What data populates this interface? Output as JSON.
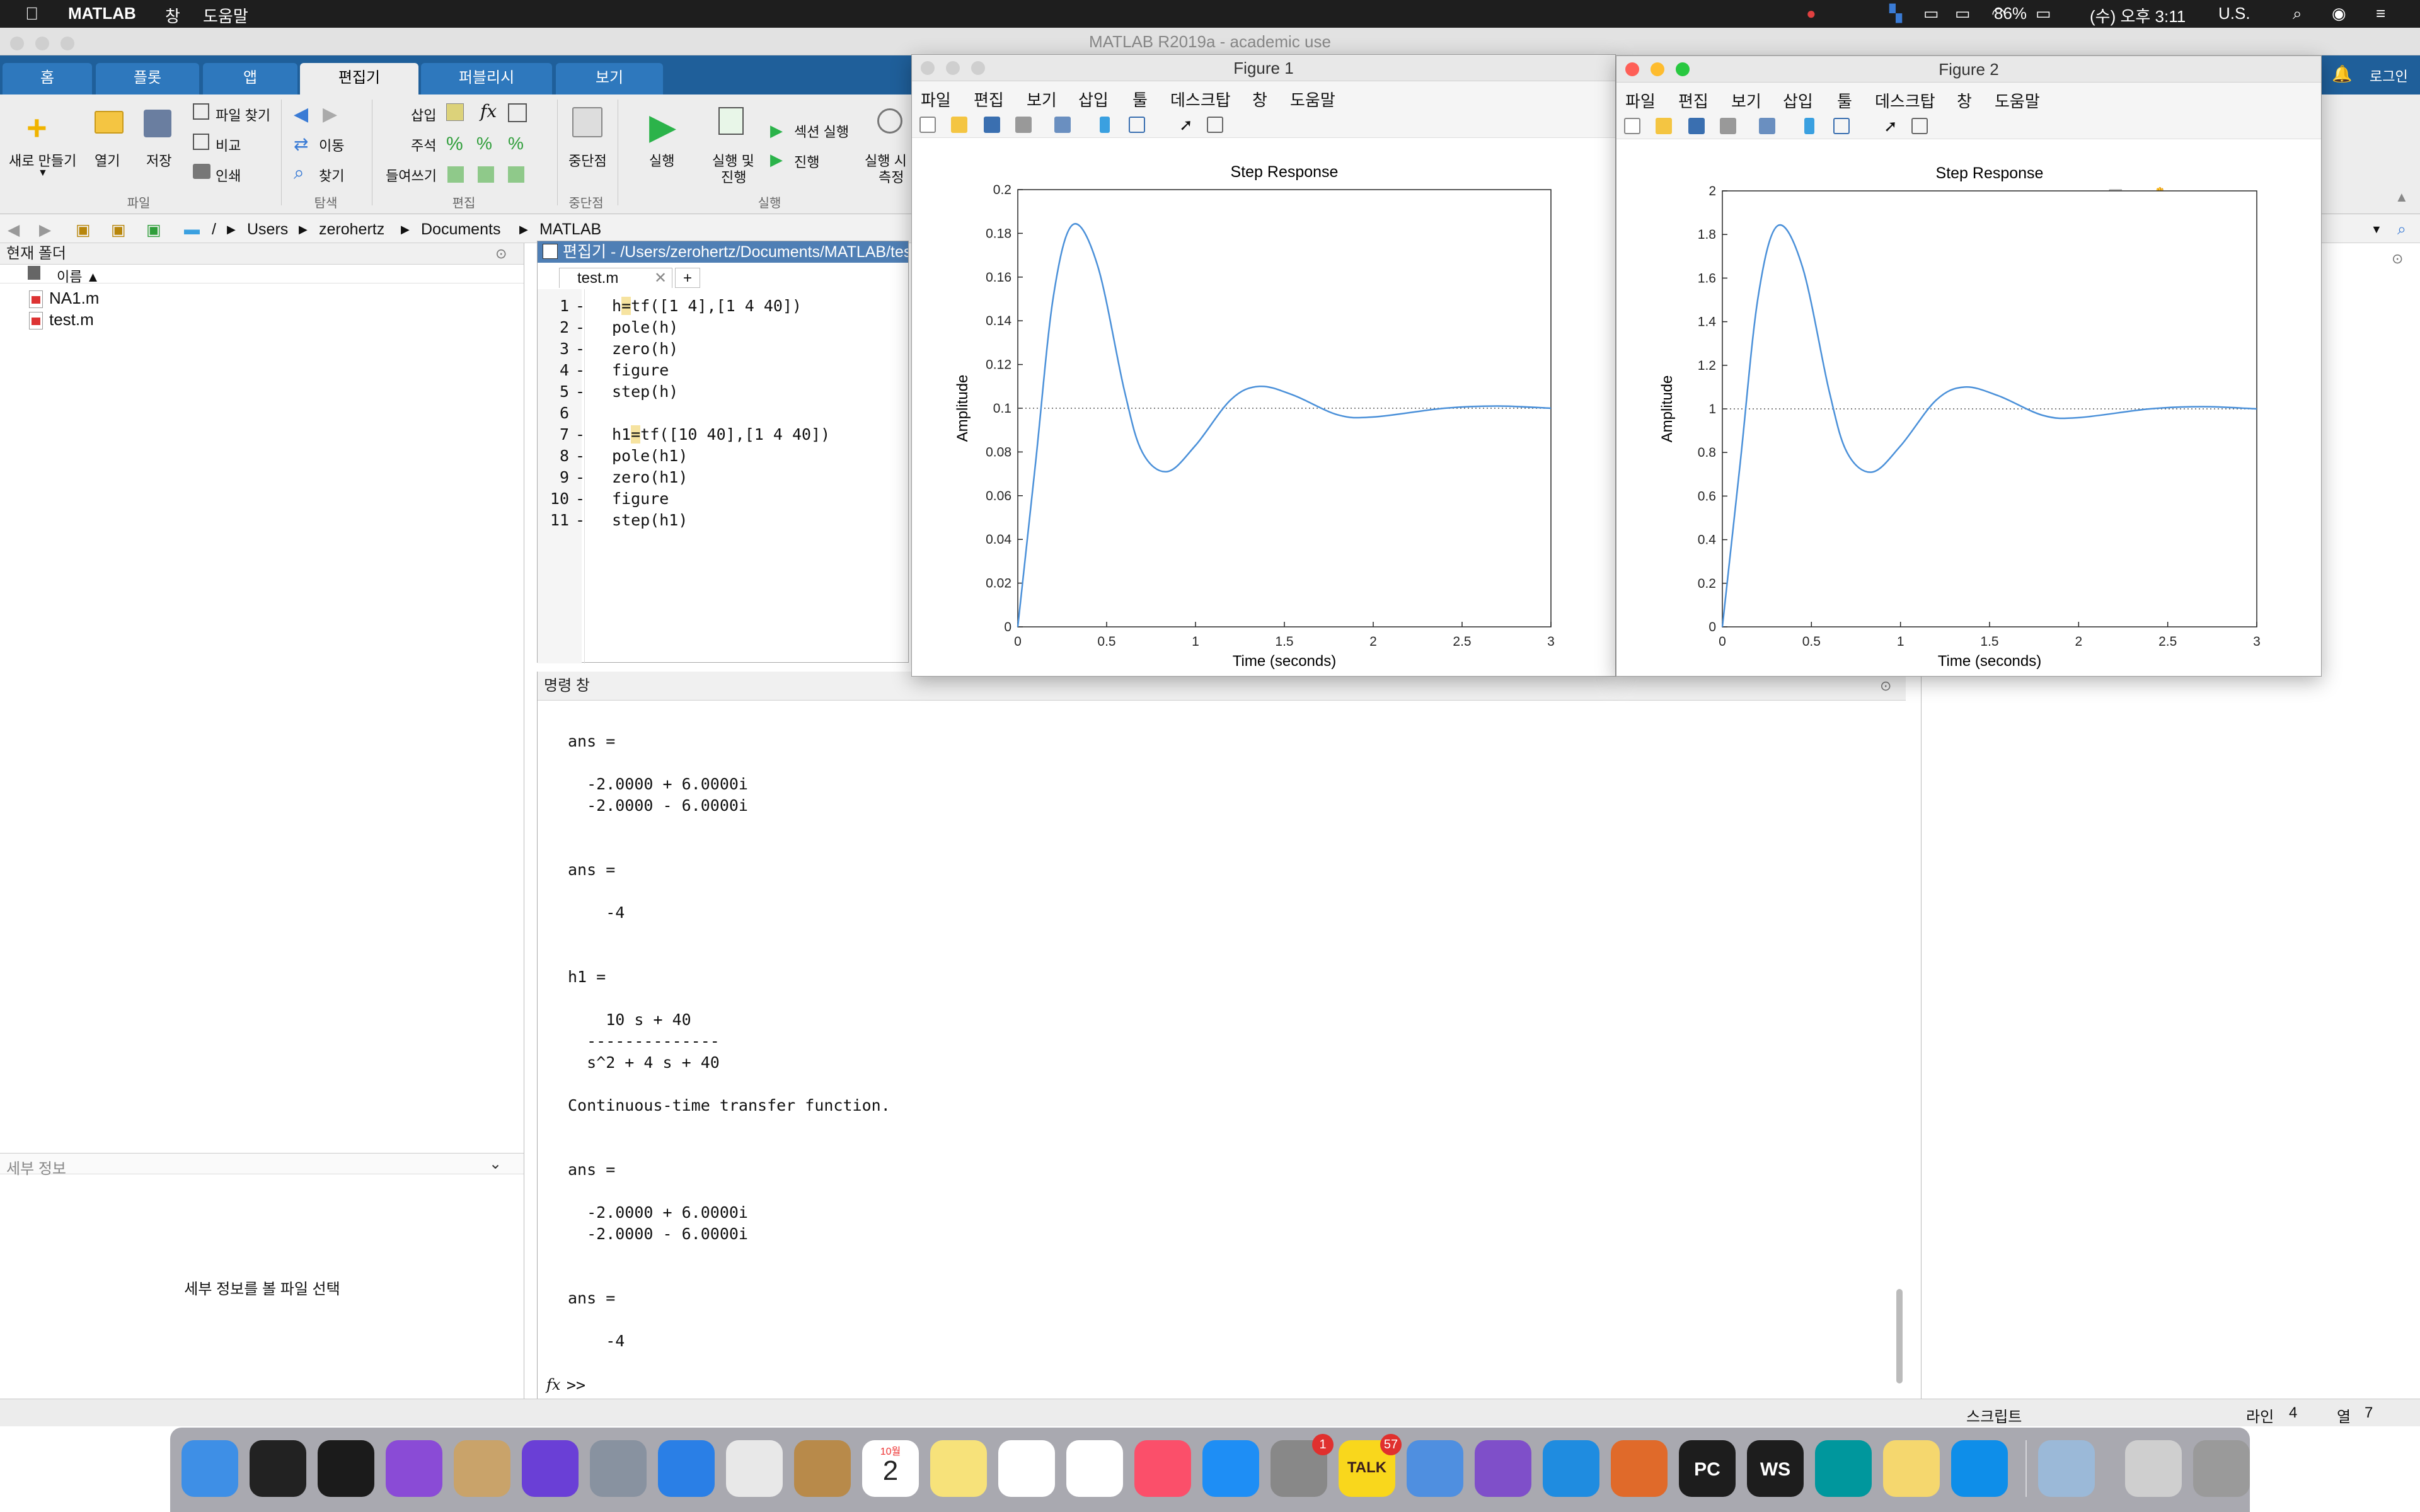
{
  "menubar": {
    "app_name": "MATLAB",
    "items": [
      "창",
      "도움말"
    ],
    "battery": "86%",
    "clock": "(수) 오후 3:11",
    "input_source": "U.S."
  },
  "window": {
    "title": "MATLAB R2019a - academic use"
  },
  "ribbon": {
    "tabs": [
      "홈",
      "플롯",
      "앱",
      "편집기",
      "퍼블리시",
      "보기"
    ],
    "active_tab": "편집기",
    "login_label": "로그인",
    "file_group": {
      "label": "파일",
      "new": "새로 만들기",
      "open": "열기",
      "save": "저장",
      "find_files": "파일 찾기",
      "compare": "비교",
      "print": "인쇄"
    },
    "nav_group": {
      "label": "탐색",
      "goto": "이동",
      "find": "찾기"
    },
    "edit_group": {
      "label": "편집",
      "insert": "삽입",
      "comment": "주석",
      "indent": "들여쓰기",
      "fx": "fx"
    },
    "breakpoint_group": {
      "label": "중단점",
      "breakpoints": "중단점"
    },
    "run_group": {
      "label": "실행",
      "run": "실행",
      "run_advance_1": "실행 및",
      "run_advance_2": "진행",
      "run_section": "섹션 실행",
      "advance": "진행",
      "run_time_1": "실행 시",
      "run_time_2": "측정"
    }
  },
  "pathbar": {
    "root": "/",
    "segments": [
      "Users",
      "zerohertz",
      "Documents",
      "MATLAB"
    ]
  },
  "folder_panel": {
    "title": "현재 폴더",
    "column_name": "이름 ▲",
    "files": [
      "NA1.m",
      "test.m"
    ],
    "details_title": "세부 정보",
    "details_hint": "세부 정보를 볼 파일 선택"
  },
  "editor": {
    "header": "편집기 - /Users/zerohertz/Documents/MATLAB/test.m",
    "tab": "test.m",
    "add_tab": "+",
    "lines": [
      {
        "n": "1",
        "d": "-",
        "pre": "h",
        "hl": "=",
        "post": "tf([1 4],[1 4 40])"
      },
      {
        "n": "2",
        "d": "-",
        "pre": "pole(h)",
        "hl": "",
        "post": ""
      },
      {
        "n": "3",
        "d": "-",
        "pre": "zero(h)",
        "hl": "",
        "post": ""
      },
      {
        "n": "4",
        "d": "-",
        "pre": "figure",
        "hl": "",
        "post": ""
      },
      {
        "n": "5",
        "d": "-",
        "pre": "step(h)",
        "hl": "",
        "post": ""
      },
      {
        "n": "6",
        "d": "",
        "pre": "",
        "hl": "",
        "post": ""
      },
      {
        "n": "7",
        "d": "-",
        "pre": "h1",
        "hl": "=",
        "post": "tf([10 40],[1 4 40])"
      },
      {
        "n": "8",
        "d": "-",
        "pre": "pole(h1)",
        "hl": "",
        "post": ""
      },
      {
        "n": "9",
        "d": "-",
        "pre": "zero(h1)",
        "hl": "",
        "post": ""
      },
      {
        "n": "10",
        "d": "-",
        "pre": "figure",
        "hl": "",
        "post": ""
      },
      {
        "n": "11",
        "d": "-",
        "pre": "step(h1)",
        "hl": "",
        "post": ""
      }
    ]
  },
  "command_window": {
    "title": "명령 창",
    "lines": [
      "ans =",
      "",
      "  -2.0000 + 6.0000i",
      "  -2.0000 - 6.0000i",
      "",
      "",
      "ans =",
      "",
      "    -4",
      "",
      "",
      "h1 =",
      "",
      "    10 s + 40",
      "  --------------",
      "  s^2 + 4 s + 40",
      "",
      "Continuous-time transfer function.",
      "",
      "",
      "ans =",
      "",
      "  -2.0000 + 6.0000i",
      "  -2.0000 - 6.0000i",
      "",
      "",
      "ans =",
      "",
      "    -4"
    ],
    "prompt": ">>",
    "fx_label": "fx"
  },
  "status_bar": {
    "mode": "스크립트",
    "line_label": "라인",
    "line_value": "4",
    "col_label": "열",
    "col_value": "7"
  },
  "figure_menu": [
    "파일",
    "편집",
    "보기",
    "삽입",
    "툴",
    "데스크탑",
    "창",
    "도움말"
  ],
  "figures": [
    {
      "title": "Figure 1",
      "chart_data": {
        "type": "line",
        "title": "Step Response",
        "xlabel": "Time (seconds)",
        "ylabel": "Amplitude",
        "xlim": [
          0,
          3
        ],
        "ylim": [
          0,
          0.2
        ],
        "xticks": [
          "0",
          "0.5",
          "1",
          "1.5",
          "2",
          "2.5",
          "3"
        ],
        "yticks": [
          "0",
          "0.02",
          "0.04",
          "0.06",
          "0.08",
          "0.1",
          "0.12",
          "0.14",
          "0.16",
          "0.18",
          "0.2"
        ],
        "final_value": 0.1,
        "series": [
          {
            "x": [
              0,
              0.1,
              0.2,
              0.31,
              0.45,
              0.6,
              0.7,
              0.84,
              1.0,
              1.2,
              1.36,
              1.55,
              1.8,
              2.0,
              2.4,
              2.7,
              3.0
            ],
            "values": [
              0,
              0.075,
              0.151,
              0.184,
              0.165,
              0.108,
              0.08,
              0.071,
              0.083,
              0.104,
              0.11,
              0.106,
              0.097,
              0.096,
              0.1,
              0.101,
              0.1
            ]
          }
        ],
        "line_color": "#4a90d9"
      }
    },
    {
      "title": "Figure 2",
      "chart_data": {
        "type": "line",
        "title": "Step Response",
        "xlabel": "Time (seconds)",
        "ylabel": "Amplitude",
        "xlim": [
          0,
          3
        ],
        "ylim": [
          0,
          2
        ],
        "xticks": [
          "0",
          "0.5",
          "1",
          "1.5",
          "2",
          "2.5",
          "3"
        ],
        "yticks": [
          "0",
          "0.2",
          "0.4",
          "0.6",
          "0.8",
          "1",
          "1.2",
          "1.4",
          "1.6",
          "1.8",
          "2"
        ],
        "final_value": 1,
        "series": [
          {
            "x": [
              0,
              0.1,
              0.2,
              0.31,
              0.45,
              0.6,
              0.7,
              0.84,
              1.0,
              1.2,
              1.36,
              1.55,
              1.8,
              2.0,
              2.4,
              2.7,
              3.0
            ],
            "values": [
              0,
              0.75,
              1.51,
              1.84,
              1.65,
              1.08,
              0.8,
              0.71,
              0.83,
              1.04,
              1.1,
              1.06,
              0.97,
              0.96,
              1.0,
              1.01,
              1.0
            ]
          }
        ],
        "line_color": "#4a90d9"
      }
    }
  ],
  "dock": {
    "apps": [
      "finder-icon",
      "terminal-icon",
      "activity-monitor-icon",
      "siri-icon",
      "garageband-icon",
      "imovie-icon",
      "launchpad-icon",
      "safari-icon",
      "chrome-icon",
      "preview-icon",
      "calendar-icon",
      "notes-icon",
      "reminders-icon",
      "photos-icon",
      "music-icon",
      "app-store-icon",
      "system-preferences-icon",
      "kakaotalk-icon",
      "xcode-icon",
      "visual-studio-icon",
      "vscode-icon",
      "matlab-icon",
      "pycharm-icon",
      "webstorm-icon",
      "arduino-icon",
      "stickies-icon",
      "teamviewer-icon",
      "preview-photos-icon",
      "documents-icon",
      "trash-icon"
    ],
    "calendar_month": "10월",
    "calendar_day": "2",
    "badge_system_preferences": "1",
    "badge_kakaotalk": "57",
    "kakao_label": "TALK",
    "pycharm_label": "PC",
    "webstorm_label": "WS"
  }
}
